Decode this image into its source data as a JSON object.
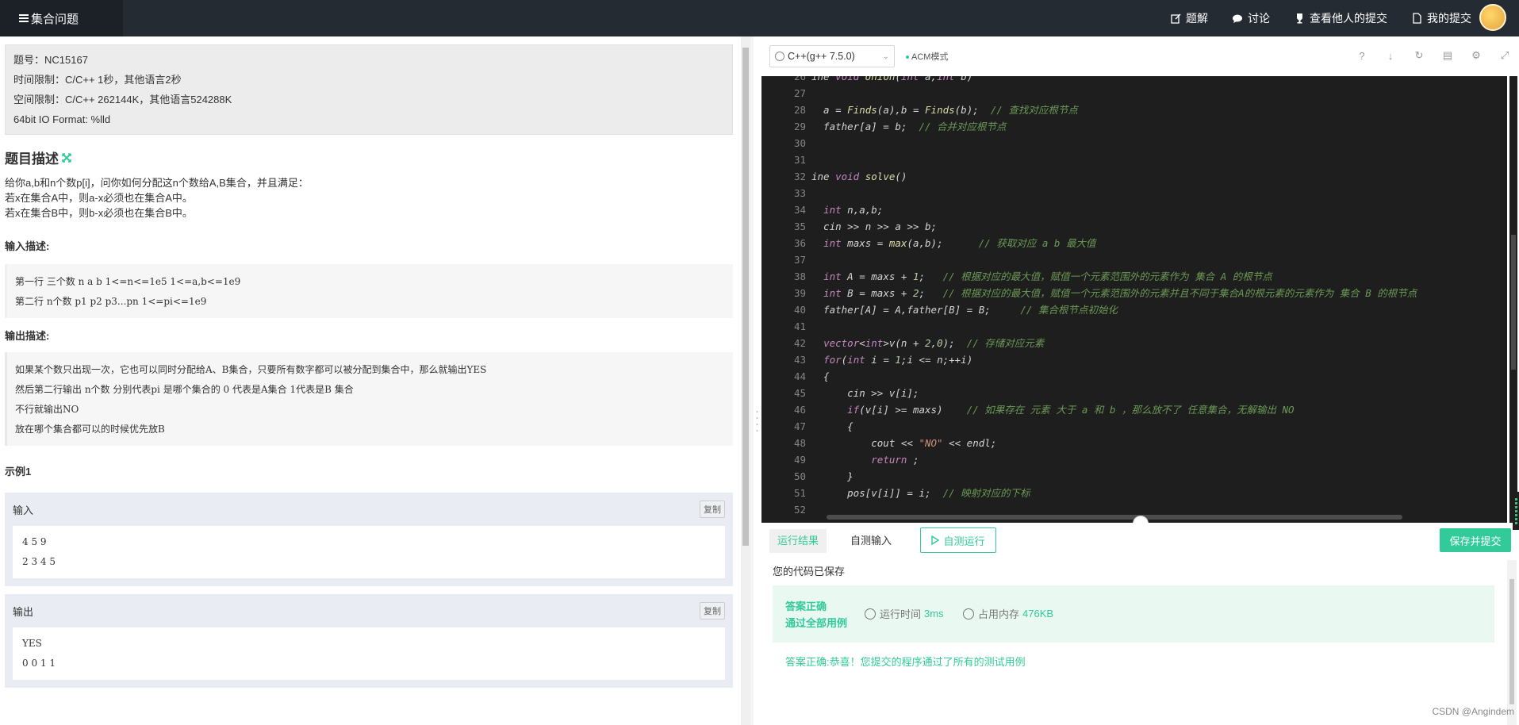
{
  "header": {
    "title": "集合问题",
    "nav": [
      {
        "label": "题解",
        "icon": "edit-icon"
      },
      {
        "label": "讨论",
        "icon": "chat-icon"
      },
      {
        "label": "查看他人的提交",
        "icon": "trophy-icon"
      },
      {
        "label": "我的提交",
        "icon": "document-icon"
      }
    ]
  },
  "problem": {
    "info": [
      "题号：NC15167",
      "时间限制：C/C++ 1秒，其他语言2秒",
      "空间限制：C/C++ 262144K，其他语言524288K",
      "64bit IO Format: %lld"
    ],
    "desc_title": "题目描述",
    "desc": [
      "给你a,b和n个数p[i]，问你如何分配这n个数给A,B集合，并且满足：",
      "若x在集合A中，则a-x必须也在集合A中。",
      "若x在集合B中，则b-x必须也在集合B中。"
    ],
    "input_title": "输入描述:",
    "input_desc": [
      "第一行 三个数 n a b  1<=n<=1e5  1<=a,b<=1e9",
      "第二行 n个数 p1 p2 p3...pn 1<=pi<=1e9"
    ],
    "output_title": "输出描述:",
    "output_desc": [
      "如果某个数只出现一次，它也可以同时分配给A、B集合，只要所有数字都可以被分配到集合中，那么就输出YES",
      "然后第二行输出 n个数 分别代表pi 是哪个集合的  0 代表是A集合 1代表是B 集合",
      "不行就输出NO",
      "放在哪个集合都可以的时候优先放B"
    ],
    "example_title": "示例1",
    "example": {
      "input_label": "输入",
      "input": [
        "4 5 9",
        "2 3 4 5"
      ],
      "output_label": "输出",
      "output": [
        "YES",
        "0 0 1 1"
      ],
      "copy_label": "复制"
    }
  },
  "editor": {
    "language": "C++(g++ 7.5.0)",
    "mode": "ACM模式",
    "lines": [
      {
        "n": "26",
        "code": "ine void Union(int a,int b)"
      },
      {
        "n": "27",
        "code": ""
      },
      {
        "n": "28",
        "code": "  a = Finds(a),b = Finds(b);  // 查找对应根节点"
      },
      {
        "n": "29",
        "code": "  father[a] = b;  // 合并对应根节点"
      },
      {
        "n": "30",
        "code": ""
      },
      {
        "n": "31",
        "code": ""
      },
      {
        "n": "32",
        "code": "ine void solve()"
      },
      {
        "n": "33",
        "code": ""
      },
      {
        "n": "34",
        "code": "  int n,a,b;"
      },
      {
        "n": "35",
        "code": "  cin >> n >> a >> b;"
      },
      {
        "n": "36",
        "code": "  int maxs = max(a,b);      // 获取对应 a b 最大值"
      },
      {
        "n": "37",
        "code": ""
      },
      {
        "n": "38",
        "code": "  int A = maxs + 1;   // 根据对应的最大值，赋值一个元素范围外的元素作为 集合 A 的根节点"
      },
      {
        "n": "39",
        "code": "  int B = maxs + 2;   // 根据对应的最大值，赋值一个元素范围外的元素并且不同于集合A的根元素的元素作为 集合 B 的根节点"
      },
      {
        "n": "40",
        "code": "  father[A] = A,father[B] = B;     // 集合根节点初始化"
      },
      {
        "n": "41",
        "code": ""
      },
      {
        "n": "42",
        "code": "  vector<int>v(n + 2,0);  // 存储对应元素"
      },
      {
        "n": "43",
        "code": "  for(int i = 1;i <= n;++i)"
      },
      {
        "n": "44",
        "code": "  {"
      },
      {
        "n": "45",
        "code": "      cin >> v[i];"
      },
      {
        "n": "46",
        "code": "      if(v[i] >= maxs)    // 如果存在 元素 大于 a 和 b ，那么放不了 任意集合，无解输出 NO"
      },
      {
        "n": "47",
        "code": "      {"
      },
      {
        "n": "48",
        "code": "          cout << \"NO\" << endl;"
      },
      {
        "n": "49",
        "code": "          return ;"
      },
      {
        "n": "50",
        "code": "      }"
      },
      {
        "n": "51",
        "code": "      pos[v[i]] = i;  // 映射对应的下标"
      },
      {
        "n": "52",
        "code": ""
      }
    ]
  },
  "results": {
    "tab_result": "运行结果",
    "tab_self_input": "自测输入",
    "run_button": "自测运行",
    "submit_button": "保存并提交",
    "saved": "您的代码已保存",
    "status_line1": "答案正确",
    "status_line2": "通过全部用例",
    "time_label": "运行时间",
    "time_value": "3ms",
    "mem_label": "占用内存",
    "mem_value": "476KB",
    "congrats": "答案正确:恭喜！您提交的程序通过了所有的测试用例"
  },
  "watermark": "CSDN @Angindem",
  "colors": {
    "accent": "#32ca99",
    "header_bg": "#252b33",
    "editor_bg": "#1e1e1e"
  }
}
